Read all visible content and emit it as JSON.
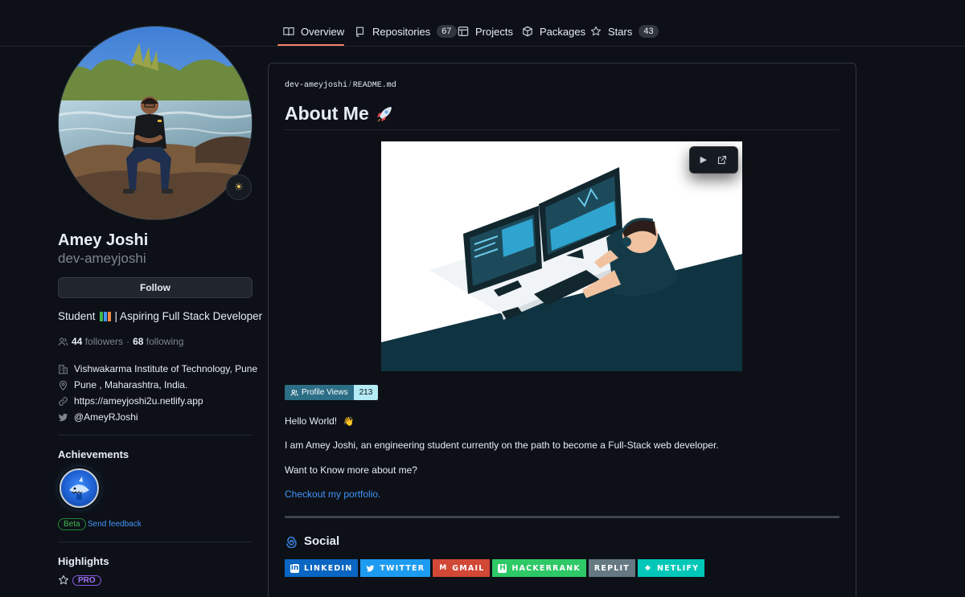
{
  "nav": {
    "tabs": [
      {
        "label": "Overview",
        "icon": "book-icon"
      },
      {
        "label": "Repositories",
        "icon": "repo-icon",
        "count": "67"
      },
      {
        "label": "Projects",
        "icon": "table-icon"
      },
      {
        "label": "Packages",
        "icon": "package-icon"
      },
      {
        "label": "Stars",
        "icon": "star-icon",
        "count": "43"
      }
    ],
    "active_tab": "Overview"
  },
  "profile": {
    "status_emoji": "☀",
    "full_name": "Amey Joshi",
    "username": "dev-ameyjoshi",
    "follow_label": "Follow",
    "bio_prefix": "Student",
    "bio_suffix": "| Aspiring Full Stack Developer",
    "followers_count": "44",
    "followers_label": "followers",
    "dot": "·",
    "following_count": "68",
    "following_label": "following",
    "organization": "Vishwakarma Institute of Technology, Pune",
    "location": "Pune , Maharashtra, India.",
    "website": "https://ameyjoshi2u.netlify.app",
    "twitter": "@AmeyRJoshi"
  },
  "achievements": {
    "heading": "Achievements",
    "beta_label": "Beta",
    "feedback_label": "Send feedback"
  },
  "highlights": {
    "heading": "Highlights",
    "pro_label": "PRO"
  },
  "readme": {
    "path_user": "dev-ameyjoshi",
    "path_sep": "/",
    "path_file": "README.md",
    "title": "About Me",
    "title_emoji": "🚀",
    "views_label": "Profile Views",
    "views_count": "213",
    "greeting": "Hello World!",
    "greeting_emoji": "👋",
    "intro": "I am Amey Joshi, an engineering student currently on the path to become a Full-Stack web developer.",
    "question": "Want to Know more about me?",
    "portfolio_link": "Checkout my portfolio.",
    "social_heading": "Social",
    "social_badges": [
      {
        "label": "LINKEDIN",
        "color": "#0a66c2",
        "icon": "linkedin-icon",
        "glyph": "in"
      },
      {
        "label": "TWITTER",
        "color": "#1d9bf0",
        "icon": "twitter-icon",
        "glyph": "✈"
      },
      {
        "label": "GMAIL",
        "color": "#d14836",
        "icon": "gmail-icon",
        "glyph": "M"
      },
      {
        "label": "HACKERRANK",
        "color": "#2ec866",
        "icon": "hackerrank-icon",
        "glyph": "H"
      },
      {
        "label": "REPLIT",
        "color": "#667881",
        "icon": "replit-icon",
        "glyph": ""
      },
      {
        "label": "NETLIFY",
        "color": "#00c7b7",
        "icon": "netlify-icon",
        "glyph": "◆"
      }
    ]
  },
  "colors": {
    "background": "#0d1117",
    "border": "#30363d",
    "link": "#4493f8",
    "active_tab_underline": "#f78166",
    "views_left": "#2c6e86",
    "views_right": "#b4ebf4"
  }
}
